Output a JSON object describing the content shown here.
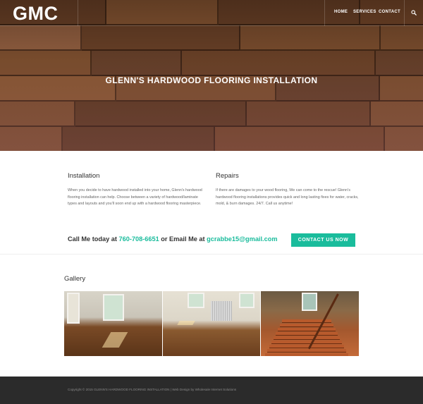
{
  "header": {
    "logo": "GMC",
    "nav": [
      "HOME",
      "SERVICES",
      "CONTACT"
    ]
  },
  "hero": {
    "title": "GLENN'S HARDWOOD FLOORING INSTALLATION"
  },
  "services": [
    {
      "title": "Installation",
      "body": "When you decide to have hardwood installed into your home, Glenn's hardwood flooring installation can help. Choose between a variety of hardwood/laminate types and layouts and you'll soon end up with a hardwood flooring masterpiece."
    },
    {
      "title": "Repairs",
      "body": "If there are damages to your wood flooring, We can come to the rescue! Glenn's hardwood flooring installations provides quick and long lasting fixes for water, cracks, mold, & burn damages. 24/7. Call us anytime!"
    }
  ],
  "cta": {
    "prefix": "Call Me today at ",
    "phone": "760-708-6651",
    "middle": " or Email Me at ",
    "email": "gcrabbe15@gmail.com",
    "button": "CONTACT US NOW"
  },
  "gallery": {
    "title": "Gallery"
  },
  "footer": {
    "text": "Copyright © 2015 GLENN'S HARDWOOD FLOORING INSTALLATION | Web Design by Wholesale Internet Solutions"
  },
  "colors": {
    "accent": "#1abc9c",
    "footer_bg": "#2b2b2b"
  },
  "icons": {
    "search": "search-icon"
  }
}
